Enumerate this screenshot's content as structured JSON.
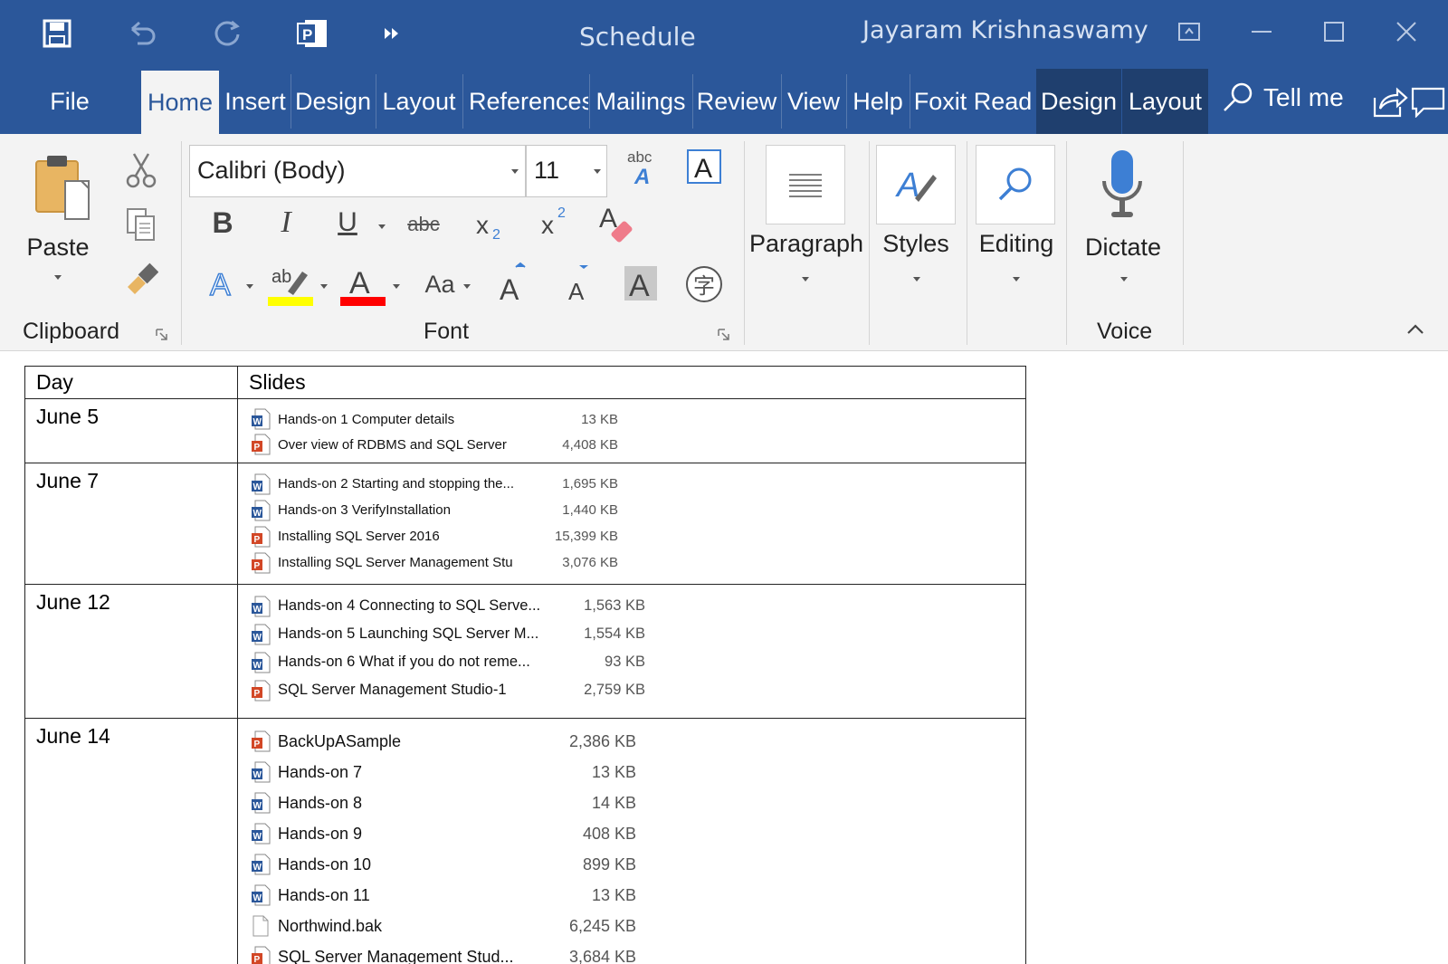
{
  "window": {
    "doc_title": "Schedule",
    "user_name": "Jayaram Krishnaswamy"
  },
  "tabs": [
    "File",
    "Home",
    "Insert",
    "Design",
    "Layout",
    "References",
    "Mailings",
    "Review",
    "View",
    "Help",
    "Foxit Read",
    "Design",
    "Layout"
  ],
  "tell_me": "Tell me",
  "ribbon": {
    "clipboard": {
      "paste_label": "Paste",
      "group_label": "Clipboard"
    },
    "font": {
      "font_name": "Calibri (Body)",
      "font_size": "11",
      "group_label": "Font",
      "case_label": "Aa",
      "highlight_color": "#ffff00",
      "font_color": "#ff0000"
    },
    "paragraph": {
      "label": "Paragraph"
    },
    "styles": {
      "label": "Styles"
    },
    "editing": {
      "label": "Editing"
    },
    "dictate": {
      "label": "Dictate",
      "group_label": "Voice"
    }
  },
  "table": {
    "headers": [
      "Day",
      "Slides"
    ],
    "rows": [
      {
        "day": "June 5",
        "files": [
          {
            "icon": "word",
            "name": "Hands-on 1 Computer details",
            "size": "13 KB"
          },
          {
            "icon": "ppt",
            "name": "Over view of RDBMS and SQL Server",
            "size": "4,408 KB"
          }
        ]
      },
      {
        "day": "June 7",
        "files": [
          {
            "icon": "word",
            "name": "Hands-on 2 Starting and stopping the...",
            "size": "1,695 KB"
          },
          {
            "icon": "word",
            "name": "Hands-on 3 VerifyInstallation",
            "size": "1,440 KB"
          },
          {
            "icon": "ppt",
            "name": "Installing SQL Server 2016",
            "size": "15,399 KB"
          },
          {
            "icon": "ppt",
            "name": "Installing SQL Server Management Stu",
            "size": "3,076 KB"
          }
        ]
      },
      {
        "day": "June 12",
        "files": [
          {
            "icon": "word",
            "name": "Hands-on 4 Connecting to SQL Serve...",
            "size": "1,563 KB"
          },
          {
            "icon": "word",
            "name": "Hands-on 5 Launching SQL Server M...",
            "size": "1,554 KB"
          },
          {
            "icon": "word",
            "name": "Hands-on 6 What if you do not reme...",
            "size": "93 KB"
          },
          {
            "icon": "ppt",
            "name": "SQL Server Management Studio-1",
            "size": "2,759 KB"
          }
        ]
      },
      {
        "day": "June 14",
        "files": [
          {
            "icon": "ppt",
            "name": "BackUpASample",
            "size": "2,386 KB"
          },
          {
            "icon": "word",
            "name": "Hands-on 7",
            "size": "13 KB"
          },
          {
            "icon": "word",
            "name": "Hands-on 8",
            "size": "14 KB"
          },
          {
            "icon": "word",
            "name": "Hands-on 9",
            "size": "408 KB"
          },
          {
            "icon": "word",
            "name": "Hands-on 10",
            "size": "899 KB"
          },
          {
            "icon": "word",
            "name": "Hands-on 11",
            "size": "13 KB"
          },
          {
            "icon": "file",
            "name": "Northwind.bak",
            "size": "6,245 KB"
          },
          {
            "icon": "ppt",
            "name": "SQL Server Management Stud...",
            "size": "3,684 KB"
          }
        ]
      }
    ]
  },
  "colors": {
    "ribbon_blue": "#2b579a",
    "ribbon_bg": "#f3f3f3",
    "word_blue": "#2b579a",
    "ppt_red": "#d24726"
  }
}
